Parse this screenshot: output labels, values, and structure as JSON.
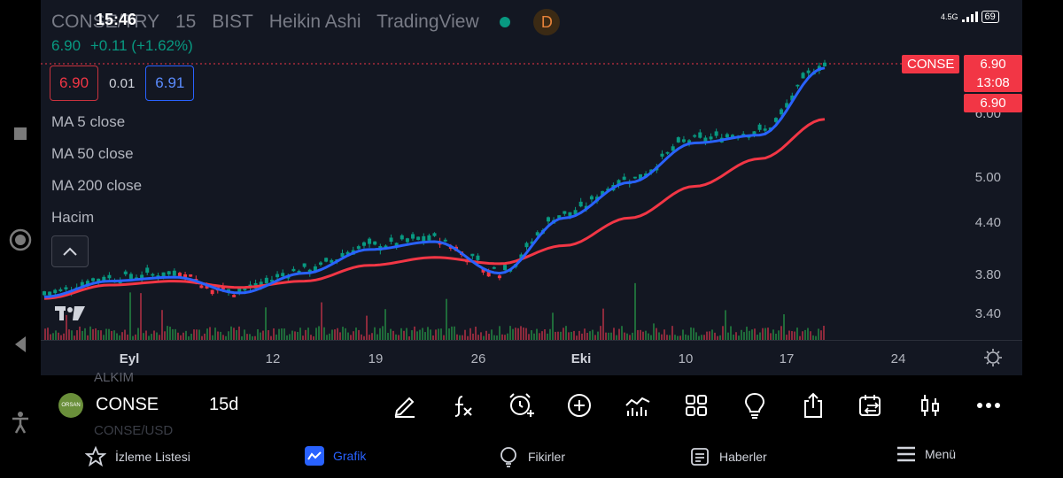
{
  "status_bar": {
    "time": "15:46",
    "network": "4.5G",
    "battery": "69"
  },
  "legend": {
    "symbol": "CONSE/TRY",
    "interval": "15",
    "exchange": "BIST",
    "chart_type": "Heikin Ashi",
    "source": "TradingView",
    "market_status": "D",
    "last_price": "6.90",
    "change": "+0.11 (+1.62%)",
    "bid": "6.90",
    "spread": "0.01",
    "ask": "6.91"
  },
  "indicators": [
    "MA 5 close",
    "MA 50 close",
    "MA 200 close",
    "Hacim"
  ],
  "colors": {
    "up": "#089981",
    "down": "#f23645",
    "ma_short": "#2962ff",
    "ma_long": "#f23645",
    "accent": "#2962ff",
    "background": "#131722"
  },
  "price_axis": {
    "labels": [
      "6.00",
      "5.00",
      "4.40",
      "3.80",
      "3.40"
    ],
    "symbol_tag": "CONSE",
    "current_price": "6.90",
    "countdown": "13:08",
    "last_tag": "6.90"
  },
  "time_axis": {
    "ticks": [
      {
        "label": "Eyl",
        "bold": true
      },
      {
        "label": "12",
        "bold": false
      },
      {
        "label": "19",
        "bold": false
      },
      {
        "label": "26",
        "bold": false
      },
      {
        "label": "Eki",
        "bold": true
      },
      {
        "label": "10",
        "bold": false
      },
      {
        "label": "17",
        "bold": false
      },
      {
        "label": "24",
        "bold": false
      }
    ]
  },
  "chart_data": {
    "type": "line",
    "title": "",
    "x": [
      "Eyl",
      "",
      "12",
      "",
      "19",
      "",
      "26",
      "",
      "Eki",
      "",
      "10",
      "",
      "17"
    ],
    "series": [
      {
        "name": "MA 5 close",
        "values": [
          3.8,
          4.0,
          4.05,
          3.85,
          4.1,
          4.4,
          4.5,
          4.1,
          4.8,
          5.25,
          5.75,
          5.85,
          6.7
        ]
      },
      {
        "name": "MA 50 close",
        "values": [
          3.78,
          3.95,
          4.0,
          3.92,
          4.0,
          4.2,
          4.3,
          4.22,
          4.45,
          4.8,
          5.2,
          5.55,
          6.05
        ]
      }
    ],
    "ylim": [
      3.3,
      7.0
    ],
    "grid": false
  },
  "symbol_bar": {
    "logo_text": "ORSAN",
    "name": "CONSE",
    "resolution": "15d",
    "prev_symbol": "ALKIM",
    "next_symbol": "CONSE/USD"
  },
  "bottom_nav": [
    {
      "label": "İzleme Listesi",
      "icon": "star-icon",
      "active": false
    },
    {
      "label": "Grafik",
      "icon": "chart-icon",
      "active": true
    },
    {
      "label": "Fikirler",
      "icon": "lightbulb-icon",
      "active": false
    },
    {
      "label": "Haberler",
      "icon": "news-icon",
      "active": false
    },
    {
      "label": "Menü",
      "icon": "menu-icon",
      "active": false
    }
  ]
}
